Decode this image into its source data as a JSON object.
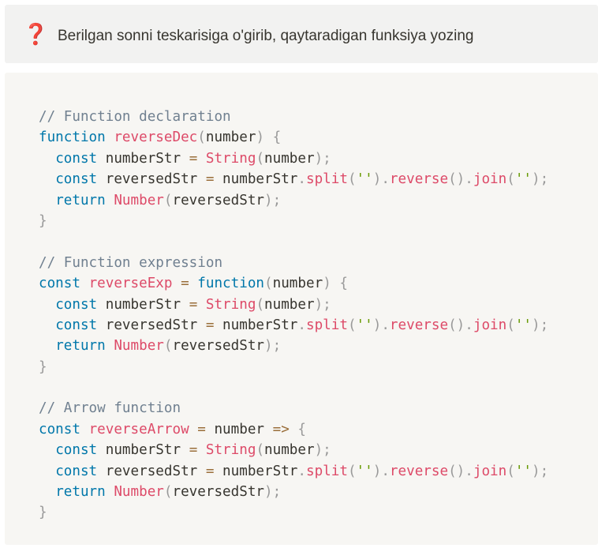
{
  "question": {
    "icon": "question-mark-icon",
    "icon_glyph": "❓",
    "text": "Berilgan sonni teskarisiga o'girib, qaytaradigan funksiya yozing"
  },
  "code": {
    "language": "javascript",
    "lines": [
      [
        [
          "cm",
          "// Function declaration"
        ]
      ],
      [
        [
          "kw",
          "function"
        ],
        [
          "id",
          " "
        ],
        [
          "fn",
          "reverseDec"
        ],
        [
          "pu",
          "("
        ],
        [
          "id",
          "number"
        ],
        [
          "pu",
          ")"
        ],
        [
          "id",
          " "
        ],
        [
          "pu",
          "{"
        ]
      ],
      [
        [
          "id",
          "  "
        ],
        [
          "kw",
          "const"
        ],
        [
          "id",
          " numberStr "
        ],
        [
          "op",
          "="
        ],
        [
          "id",
          " "
        ],
        [
          "fn",
          "String"
        ],
        [
          "pu",
          "("
        ],
        [
          "id",
          "number"
        ],
        [
          "pu",
          ");"
        ]
      ],
      [
        [
          "id",
          "  "
        ],
        [
          "kw",
          "const"
        ],
        [
          "id",
          " reversedStr "
        ],
        [
          "op",
          "="
        ],
        [
          "id",
          " numberStr"
        ],
        [
          "pu",
          "."
        ],
        [
          "fn",
          "split"
        ],
        [
          "pu",
          "("
        ],
        [
          "st",
          "''"
        ],
        [
          "pu",
          ")."
        ],
        [
          "fn",
          "reverse"
        ],
        [
          "pu",
          "()."
        ],
        [
          "fn",
          "join"
        ],
        [
          "pu",
          "("
        ],
        [
          "st",
          "''"
        ],
        [
          "pu",
          ");"
        ]
      ],
      [
        [
          "id",
          "  "
        ],
        [
          "kw",
          "return"
        ],
        [
          "id",
          " "
        ],
        [
          "fn",
          "Number"
        ],
        [
          "pu",
          "("
        ],
        [
          "id",
          "reversedStr"
        ],
        [
          "pu",
          ");"
        ]
      ],
      [
        [
          "pu",
          "}"
        ]
      ],
      [],
      [
        [
          "cm",
          "// Function expression"
        ]
      ],
      [
        [
          "kw",
          "const"
        ],
        [
          "id",
          " "
        ],
        [
          "fn",
          "reverseExp"
        ],
        [
          "id",
          " "
        ],
        [
          "op",
          "="
        ],
        [
          "id",
          " "
        ],
        [
          "kw",
          "function"
        ],
        [
          "pu",
          "("
        ],
        [
          "id",
          "number"
        ],
        [
          "pu",
          ")"
        ],
        [
          "id",
          " "
        ],
        [
          "pu",
          "{"
        ]
      ],
      [
        [
          "id",
          "  "
        ],
        [
          "kw",
          "const"
        ],
        [
          "id",
          " numberStr "
        ],
        [
          "op",
          "="
        ],
        [
          "id",
          " "
        ],
        [
          "fn",
          "String"
        ],
        [
          "pu",
          "("
        ],
        [
          "id",
          "number"
        ],
        [
          "pu",
          ");"
        ]
      ],
      [
        [
          "id",
          "  "
        ],
        [
          "kw",
          "const"
        ],
        [
          "id",
          " reversedStr "
        ],
        [
          "op",
          "="
        ],
        [
          "id",
          " numberStr"
        ],
        [
          "pu",
          "."
        ],
        [
          "fn",
          "split"
        ],
        [
          "pu",
          "("
        ],
        [
          "st",
          "''"
        ],
        [
          "pu",
          ")."
        ],
        [
          "fn",
          "reverse"
        ],
        [
          "pu",
          "()."
        ],
        [
          "fn",
          "join"
        ],
        [
          "pu",
          "("
        ],
        [
          "st",
          "''"
        ],
        [
          "pu",
          ");"
        ]
      ],
      [
        [
          "id",
          "  "
        ],
        [
          "kw",
          "return"
        ],
        [
          "id",
          " "
        ],
        [
          "fn",
          "Number"
        ],
        [
          "pu",
          "("
        ],
        [
          "id",
          "reversedStr"
        ],
        [
          "pu",
          ");"
        ]
      ],
      [
        [
          "pu",
          "}"
        ]
      ],
      [],
      [
        [
          "cm",
          "// Arrow function"
        ]
      ],
      [
        [
          "kw",
          "const"
        ],
        [
          "id",
          " "
        ],
        [
          "fn",
          "reverseArrow"
        ],
        [
          "id",
          " "
        ],
        [
          "op",
          "="
        ],
        [
          "id",
          " number "
        ],
        [
          "op",
          "=>"
        ],
        [
          "id",
          " "
        ],
        [
          "pu",
          "{"
        ]
      ],
      [
        [
          "id",
          "  "
        ],
        [
          "kw",
          "const"
        ],
        [
          "id",
          " numberStr "
        ],
        [
          "op",
          "="
        ],
        [
          "id",
          " "
        ],
        [
          "fn",
          "String"
        ],
        [
          "pu",
          "("
        ],
        [
          "id",
          "number"
        ],
        [
          "pu",
          ");"
        ]
      ],
      [
        [
          "id",
          "  "
        ],
        [
          "kw",
          "const"
        ],
        [
          "id",
          " reversedStr "
        ],
        [
          "op",
          "="
        ],
        [
          "id",
          " numberStr"
        ],
        [
          "pu",
          "."
        ],
        [
          "fn",
          "split"
        ],
        [
          "pu",
          "("
        ],
        [
          "st",
          "''"
        ],
        [
          "pu",
          ")."
        ],
        [
          "fn",
          "reverse"
        ],
        [
          "pu",
          "()."
        ],
        [
          "fn",
          "join"
        ],
        [
          "pu",
          "("
        ],
        [
          "st",
          "''"
        ],
        [
          "pu",
          ");"
        ]
      ],
      [
        [
          "id",
          "  "
        ],
        [
          "kw",
          "return"
        ],
        [
          "id",
          " "
        ],
        [
          "fn",
          "Number"
        ],
        [
          "pu",
          "("
        ],
        [
          "id",
          "reversedStr"
        ],
        [
          "pu",
          ");"
        ]
      ],
      [
        [
          "pu",
          "}"
        ]
      ]
    ]
  },
  "colors": {
    "callout_bg": "#f2f2f1",
    "code_bg": "#f7f6f3",
    "text": "#37352f",
    "question_icon": "#e03e3e",
    "comment": "#708090",
    "keyword": "#0077aa",
    "function": "#dd4a68",
    "punctuation": "#999999",
    "string": "#669900",
    "operator": "#9a6e3a"
  }
}
